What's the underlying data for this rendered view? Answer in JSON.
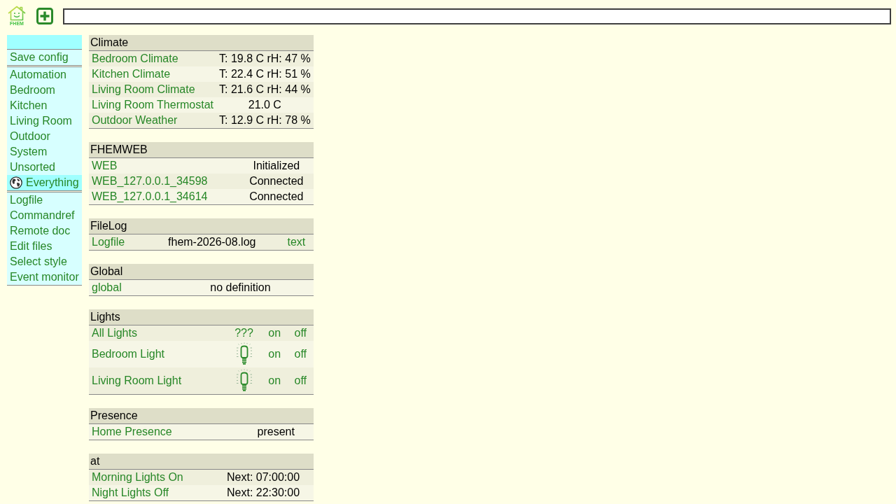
{
  "header": {
    "logo_text": "FHEM"
  },
  "menu": {
    "sections": [
      {
        "items": [
          {
            "label": "Save config",
            "kind": "link",
            "selected": false
          }
        ]
      },
      {
        "items": [
          {
            "label": "Automation",
            "kind": "link",
            "selected": false
          },
          {
            "label": "Bedroom",
            "kind": "link",
            "selected": false
          },
          {
            "label": "Kitchen",
            "kind": "link",
            "selected": false
          },
          {
            "label": "Living Room",
            "kind": "link",
            "selected": false
          },
          {
            "label": "Outdoor",
            "kind": "link",
            "selected": false
          },
          {
            "label": "System",
            "kind": "link",
            "selected": false
          },
          {
            "label": "Unsorted",
            "kind": "link",
            "selected": false
          },
          {
            "label": "Everything",
            "kind": "all",
            "selected": true
          }
        ]
      },
      {
        "items": [
          {
            "label": "Logfile",
            "kind": "link",
            "selected": false
          },
          {
            "label": "Commandref",
            "kind": "link",
            "selected": false
          },
          {
            "label": "Remote doc",
            "kind": "link",
            "selected": false
          },
          {
            "label": "Edit files",
            "kind": "link",
            "selected": false
          },
          {
            "label": "Select style",
            "kind": "link",
            "selected": false
          },
          {
            "label": "Event monitor",
            "kind": "link",
            "selected": false
          }
        ]
      }
    ]
  },
  "groups": [
    {
      "title": "Climate",
      "rows": [
        {
          "name": "Bedroom Climate",
          "cells": [
            {
              "kind": "state",
              "text": "T: 19.8 C rH: 47 %"
            }
          ]
        },
        {
          "name": "Kitchen Climate",
          "cells": [
            {
              "kind": "state",
              "text": "T: 22.4 C rH: 51 %"
            }
          ]
        },
        {
          "name": "Living Room Climate",
          "cells": [
            {
              "kind": "state",
              "text": "T: 21.6 C rH: 44 %"
            }
          ]
        },
        {
          "name": "Living Room Thermostat",
          "cells": [
            {
              "kind": "state",
              "text": "21.0 C"
            }
          ]
        },
        {
          "name": "Outdoor Weather",
          "cells": [
            {
              "kind": "state",
              "text": "T: 12.9 C rH: 78 %"
            }
          ]
        }
      ]
    },
    {
      "title": "FHEMWEB",
      "rows": [
        {
          "name": "WEB",
          "cells": [
            {
              "kind": "state",
              "text": "Initialized"
            }
          ]
        },
        {
          "name": "WEB_127.0.0.1_34598",
          "cells": [
            {
              "kind": "state",
              "text": "Connected"
            }
          ]
        },
        {
          "name": "WEB_127.0.0.1_34614",
          "cells": [
            {
              "kind": "state",
              "text": "Connected"
            }
          ]
        }
      ]
    },
    {
      "title": "FileLog",
      "rows": [
        {
          "name": "Logfile",
          "cells": [
            {
              "kind": "file",
              "text": "fhem-2026-08.log"
            },
            {
              "kind": "command",
              "text": "text"
            }
          ]
        }
      ]
    },
    {
      "title": "Global",
      "rows": [
        {
          "name": "global",
          "cells": [
            {
              "kind": "state",
              "text": "no definition"
            }
          ]
        }
      ]
    },
    {
      "title": "Lights",
      "rows": [
        {
          "name": "All Lights",
          "cells": [
            {
              "kind": "state-link",
              "text": "???"
            },
            {
              "kind": "command",
              "text": "on"
            },
            {
              "kind": "command",
              "text": "off"
            }
          ]
        },
        {
          "name": "Bedroom Light",
          "cells": [
            {
              "kind": "bulb",
              "on": false
            },
            {
              "kind": "command",
              "text": "on"
            },
            {
              "kind": "command",
              "text": "off"
            }
          ]
        },
        {
          "name": "Living Room Light",
          "cells": [
            {
              "kind": "bulb",
              "on": false
            },
            {
              "kind": "command",
              "text": "on"
            },
            {
              "kind": "command",
              "text": "off"
            }
          ]
        }
      ]
    },
    {
      "title": "Presence",
      "rows": [
        {
          "name": "Home Presence",
          "cells": [
            {
              "kind": "state",
              "text": "present"
            }
          ]
        }
      ]
    },
    {
      "title": "at",
      "rows": [
        {
          "name": "Morning Lights On",
          "cells": [
            {
              "kind": "state",
              "text": "Next: 07:00:00"
            }
          ]
        },
        {
          "name": "Night Lights Off",
          "cells": [
            {
              "kind": "state",
              "text": "Next: 22:30:00"
            }
          ]
        }
      ]
    }
  ]
}
